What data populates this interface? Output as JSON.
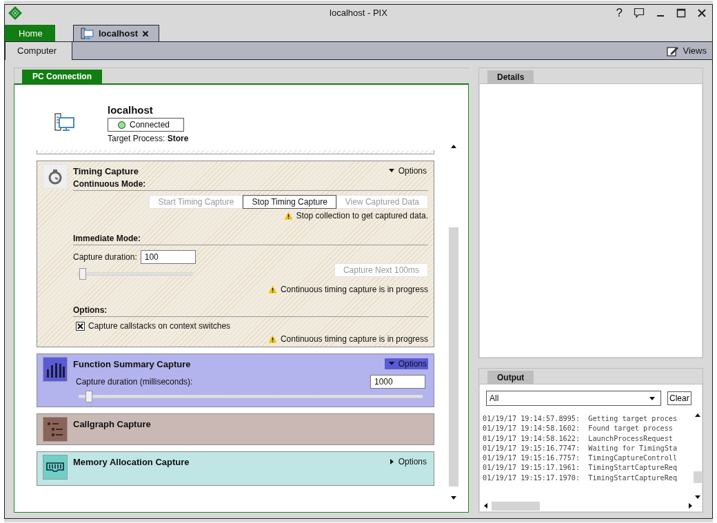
{
  "window": {
    "title": "localhost - PIX",
    "help": "?"
  },
  "tabs": [
    {
      "label": "Home",
      "selected": true,
      "kind": "home"
    },
    {
      "label": "localhost",
      "selected": false,
      "kind": "connection"
    }
  ],
  "subtabs": [
    {
      "label": "Computer",
      "selected": true
    }
  ],
  "views_button": {
    "label": "Views"
  },
  "pc_connection": {
    "title": "PC Connection",
    "host": "localhost",
    "status": "Connected",
    "connected": true,
    "target_process": "Target Process: **Store**"
  },
  "captures": [
    {
      "kind": "timing",
      "title": "Timing Capture",
      "color": "#f2ece0",
      "options": {
        "label": "Options",
        "expanded": true,
        "highlighted": false
      },
      "continuous_mode": {
        "heading": "Continuous Mode:",
        "buttons": [
          {
            "label": "Start Timing Capture",
            "disabled": true
          },
          {
            "label": "Stop Timing Capture",
            "disabled": false
          },
          {
            "label": "View Captured Data",
            "disabled": true
          }
        ],
        "warning": "Stop collection to get captured data."
      },
      "immediate_mode": {
        "heading": "Immediate Mode:",
        "duration_label": "Capture duration:",
        "duration": "100",
        "level": 0.02,
        "button": {
          "label": "Capture Next 100ms",
          "disabled": true
        },
        "warning": "Continuous timing capture is in progress"
      },
      "options_section": {
        "heading": "Options:",
        "checkbox": {
          "label": "Capture callstacks on context switches",
          "checked": true
        },
        "warning": "Continuous timing capture is in progress"
      }
    },
    {
      "kind": "function_summary",
      "title": "Function Summary Capture",
      "color": "#b3b3ee",
      "options": {
        "label": "Options",
        "expanded": true,
        "highlighted": true
      },
      "duration_label": "Capture duration (milliseconds):",
      "duration": "1000",
      "level": 0.02
    },
    {
      "kind": "callgraph",
      "title": "Callgraph Capture",
      "color": "#c9b8b4"
    },
    {
      "kind": "memory",
      "title": "Memory Allocation Capture",
      "color": "#bfe6e4",
      "options": {
        "label": "Options",
        "expanded": false,
        "highlighted": false
      }
    }
  ],
  "details": {
    "title": "Details"
  },
  "output": {
    "title": "Output",
    "filter": "All",
    "clear": "Clear",
    "lines": [
      "01/19/17 19:14:57.8995:  Getting target proces",
      "01/19/17 19:14:58.1602:  Found target process",
      "01/19/17 19:14:58.1622:  LaunchProcessRequest",
      "01/19/17 19:15:16.7747:  Waiting for TimingSta",
      "01/19/17 19:15:16.7757:  TimingCaptureControll",
      "01/19/17 19:15:17.1961:  TimingStartCaptureReq",
      "01/19/17 19:15:17.1970:  TimingStartCaptureReq"
    ]
  }
}
